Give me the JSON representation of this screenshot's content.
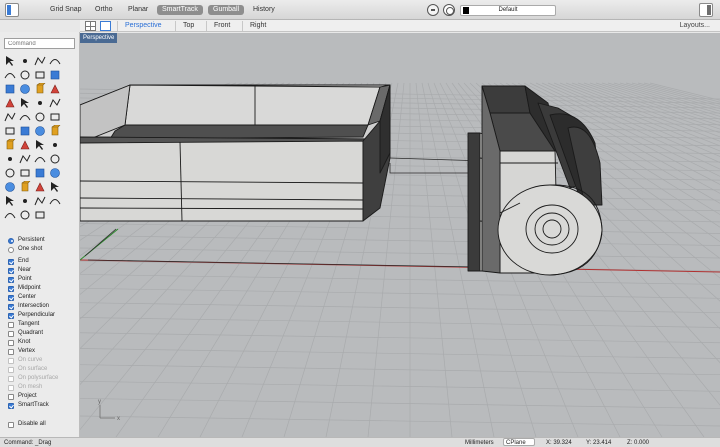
{
  "toolbar": {
    "grid_snap": "Grid Snap",
    "ortho": "Ortho",
    "planar": "Planar",
    "smarttrack": "SmartTrack",
    "gumball": "Gumball",
    "history": "History",
    "layer": "Default",
    "layer_color": "#000000"
  },
  "viewport_tabs": {
    "tabs": [
      "Perspective",
      "Top",
      "Front",
      "Right"
    ],
    "active": "Perspective",
    "layouts": "Layouts..."
  },
  "command": {
    "placeholder": "Command"
  },
  "viewport": {
    "title": "Perspective"
  },
  "axis": {
    "x": "x",
    "y": "y"
  },
  "osnaps": {
    "modes": [
      {
        "label": "Persistent",
        "on": true
      },
      {
        "label": "One shot",
        "on": false
      }
    ],
    "items": [
      {
        "label": "End",
        "checked": true,
        "enabled": true
      },
      {
        "label": "Near",
        "checked": true,
        "enabled": true
      },
      {
        "label": "Point",
        "checked": true,
        "enabled": true
      },
      {
        "label": "Midpoint",
        "checked": true,
        "enabled": true
      },
      {
        "label": "Center",
        "checked": true,
        "enabled": true
      },
      {
        "label": "Intersection",
        "checked": true,
        "enabled": true
      },
      {
        "label": "Perpendicular",
        "checked": true,
        "enabled": true
      },
      {
        "label": "Tangent",
        "checked": false,
        "enabled": true
      },
      {
        "label": "Quadrant",
        "checked": false,
        "enabled": true
      },
      {
        "label": "Knot",
        "checked": false,
        "enabled": true
      },
      {
        "label": "Vertex",
        "checked": false,
        "enabled": true
      },
      {
        "label": "On curve",
        "checked": false,
        "enabled": false
      },
      {
        "label": "On surface",
        "checked": false,
        "enabled": false
      },
      {
        "label": "On polysurface",
        "checked": false,
        "enabled": false
      },
      {
        "label": "On mesh",
        "checked": false,
        "enabled": false
      },
      {
        "label": "Project",
        "checked": false,
        "enabled": true
      },
      {
        "label": "SmartTrack",
        "checked": true,
        "enabled": true
      }
    ],
    "disable_all": "Disable all"
  },
  "status": {
    "command": "Command: _Drag",
    "units": "Millimeters",
    "cplane": "CPlane",
    "x": "X: 39.324",
    "y": "Y: 23.414",
    "z": "Z: 0.000"
  },
  "colors": {
    "accent": "#3a7bd5",
    "viewport_bg": "#b9bbbd",
    "x_axis": "#b03030",
    "y_axis": "#2e8a2e"
  },
  "tool_icons": [
    [
      "select-arrow-icon",
      "point-icon",
      "polyline-icon",
      "curve-icon"
    ],
    [
      "circle-icon",
      "arc-icon",
      "rectangle-icon",
      "fillet-curve-icon"
    ],
    [
      "offset-curve-icon",
      "extend-icon",
      "trim-icon",
      "split-icon"
    ],
    [
      "surface-corner-icon",
      "loft-icon",
      "revolve-icon",
      "network-surface-icon"
    ],
    [
      "extrude-icon",
      "sphere-icon",
      "box-icon",
      "cylinder-icon"
    ],
    [
      "boolean-union-icon",
      "fillet-edge-icon",
      "shell-icon",
      "cap-icon"
    ],
    [
      "move-icon",
      "rotate-icon",
      "scale-icon",
      "array-icon"
    ],
    [
      "mesh-icon",
      "analyze-icon",
      "dimension-icon",
      "text-icon"
    ],
    [
      "explode-icon",
      "join-icon",
      "group-icon",
      "zoom-icon"
    ],
    [
      "hide-icon",
      "lock-icon",
      "layer-icon",
      "light-icon"
    ],
    [
      "render-icon",
      "color-wheel-icon",
      "material-icon",
      "environment-icon"
    ],
    [
      "sphere-shaded-icon",
      "gumball-icon",
      "transform-icon"
    ]
  ]
}
